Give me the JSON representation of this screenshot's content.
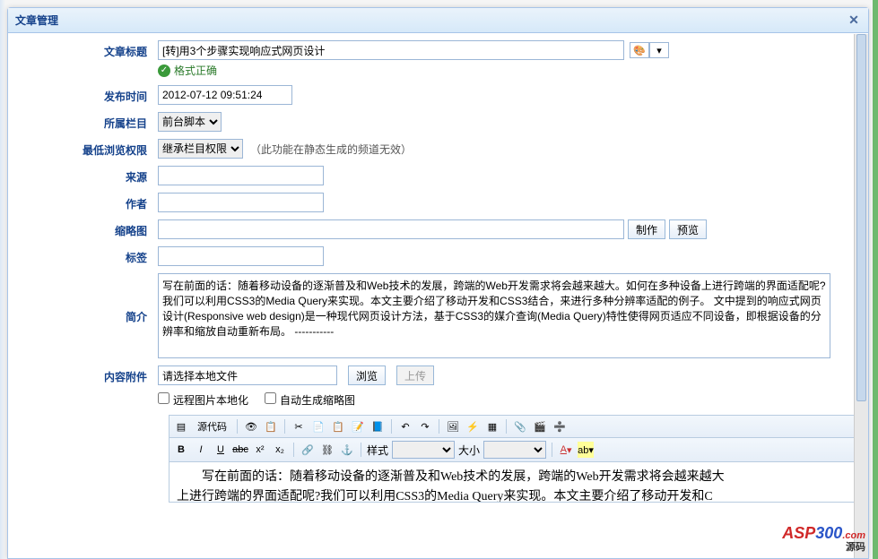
{
  "dialog": {
    "title": "文章管理"
  },
  "labels": {
    "title": "文章标题",
    "time": "发布时间",
    "column": "所属栏目",
    "perm": "最低浏览权限",
    "source": "来源",
    "author": "作者",
    "thumb": "缩略图",
    "tags": "标签",
    "intro": "简介",
    "attach": "内容附件"
  },
  "fields": {
    "title": "[转]用3个步骤实现响应式网页设计",
    "validMsg": "格式正确",
    "time": "2012-07-12 09:51:24",
    "columnOpt": "前台脚本",
    "permOpt": "继承栏目权限",
    "permNote": "（此功能在静态生成的频道无效）",
    "intro": "写在前面的话：随着移动设备的逐渐普及和Web技术的发展，跨端的Web开发需求将会越来越大。如何在多种设备上进行跨端的界面适配呢?我们可以利用CSS3的Media Query来实现。本文主要介绍了移动开发和CSS3结合，来进行多种分辨率适配的例子。 文中提到的响应式网页设计(Responsive web design)是一种现代网页设计方法，基于CSS3的媒介查询(Media Query)特性使得网页适应不同设备，即根据设备的分辨率和缩放自动重新布局。 -----------",
    "attachPh": "请选择本地文件"
  },
  "buttons": {
    "make": "制作",
    "preview": "预览",
    "browse": "浏览",
    "upload": "上传"
  },
  "checks": {
    "remoteImg": "远程图片本地化",
    "autoThumb": "自动生成缩略图"
  },
  "editor": {
    "sourceLabel": "源代码",
    "styleLabel": "样式",
    "sizeLabel": "大小",
    "body": "写在前面的话：随着移动设备的逐渐普及和Web技术的发展，跨端的Web开发需求将会越来越大\n上进行跨端的界面适配呢?我们可以利用CSS3的Media Query来实现。本文主要介绍了移动开发和C"
  },
  "logo": {
    "text1": "ASP",
    "text2": "300",
    "suffix": ".com",
    "cn": "源码"
  }
}
